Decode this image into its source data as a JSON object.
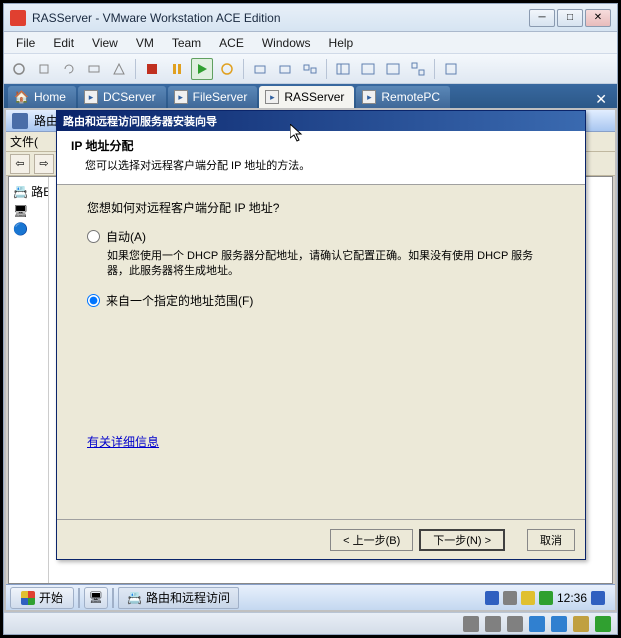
{
  "window": {
    "title": "RASServer - VMware Workstation ACE Edition"
  },
  "menu": {
    "file": "File",
    "edit": "Edit",
    "view": "View",
    "vm": "VM",
    "team": "Team",
    "ace": "ACE",
    "windows": "Windows",
    "help": "Help"
  },
  "tabs": {
    "home": "Home",
    "dcserver": "DCServer",
    "fileserver": "FileServer",
    "rasserver": "RASServer",
    "remotepc": "RemotePC"
  },
  "inner": {
    "title_short": "路由",
    "menu_file": "文件(",
    "tree_root": "路E"
  },
  "wizard": {
    "title": "路由和远程访问服务器安装向导",
    "heading": "IP 地址分配",
    "subheading": "您可以选择对远程客户端分配 IP 地址的方法。",
    "question": "您想如何对远程客户端分配 IP 地址?",
    "opt_auto": "自动(A)",
    "opt_auto_desc": "如果您使用一个 DHCP 服务器分配地址，请确认它配置正确。如果没有使用 DHCP 服务器，此服务器将生成地址。",
    "opt_range": "来自一个指定的地址范围(F)",
    "link": "有关详细信息",
    "back": "< 上一步(B)",
    "next": "下一步(N) >",
    "cancel": "取消"
  },
  "taskbar": {
    "start": "开始",
    "task1": "路由和远程访问",
    "clock": "12:36"
  }
}
